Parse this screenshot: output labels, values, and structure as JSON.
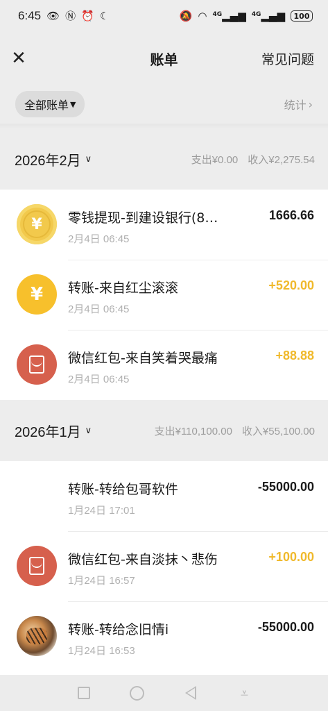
{
  "status_bar": {
    "time": "6:45",
    "left_icons": [
      "eye-icon",
      "nfc-icon",
      "alarm-icon",
      "moon-icon"
    ],
    "right_icons": [
      "mute-icon",
      "wifi-icon",
      "signal-4g-icon",
      "signal-4g-icon"
    ],
    "net_label": "4G",
    "battery": "100"
  },
  "nav": {
    "title": "账单",
    "right_link": "常见问题",
    "close_glyph": "✕"
  },
  "filter": {
    "selected": "全部账单",
    "stats_label": "统计"
  },
  "months": [
    {
      "label": "2026年2月",
      "expense": "支出¥0.00",
      "income": "收入¥2,275.54",
      "transactions": [
        {
          "title": "零钱提现-到建设银行(8…",
          "time": "2月4日 06:45",
          "amount": "1666.66",
          "type": "plain",
          "icon": "coin-icon"
        },
        {
          "title": "转账-来自红尘滚滚",
          "time": "2月4日 06:45",
          "amount": "+520.00",
          "type": "income",
          "icon": "yuan-transfer-icon"
        },
        {
          "title": "微信红包-来自笑着哭最痛",
          "time": "2月4日 06:45",
          "amount": "+88.88",
          "type": "income",
          "icon": "red-packet-icon"
        }
      ]
    },
    {
      "label": "2026年1月",
      "expense": "支出¥110,100.00",
      "income": "收入¥55,100.00",
      "transactions": [
        {
          "title": "转账-转给包哥软件",
          "time": "1月24日 17:01",
          "amount": "-55000.00",
          "type": "plain",
          "icon": "none"
        },
        {
          "title": "微信红包-来自淡抹丶悲伤",
          "time": "1月24日 16:57",
          "amount": "+100.00",
          "type": "income",
          "icon": "red-packet-icon"
        },
        {
          "title": "转账-转给念旧情i",
          "time": "1月24日 16:53",
          "amount": "-55000.00",
          "type": "plain",
          "icon": "tiger-avatar-icon"
        }
      ]
    }
  ],
  "colors": {
    "income": "#f0b92b",
    "red_packet": "#d6604d",
    "coin": "#f2c94c",
    "background": "#ededed"
  }
}
